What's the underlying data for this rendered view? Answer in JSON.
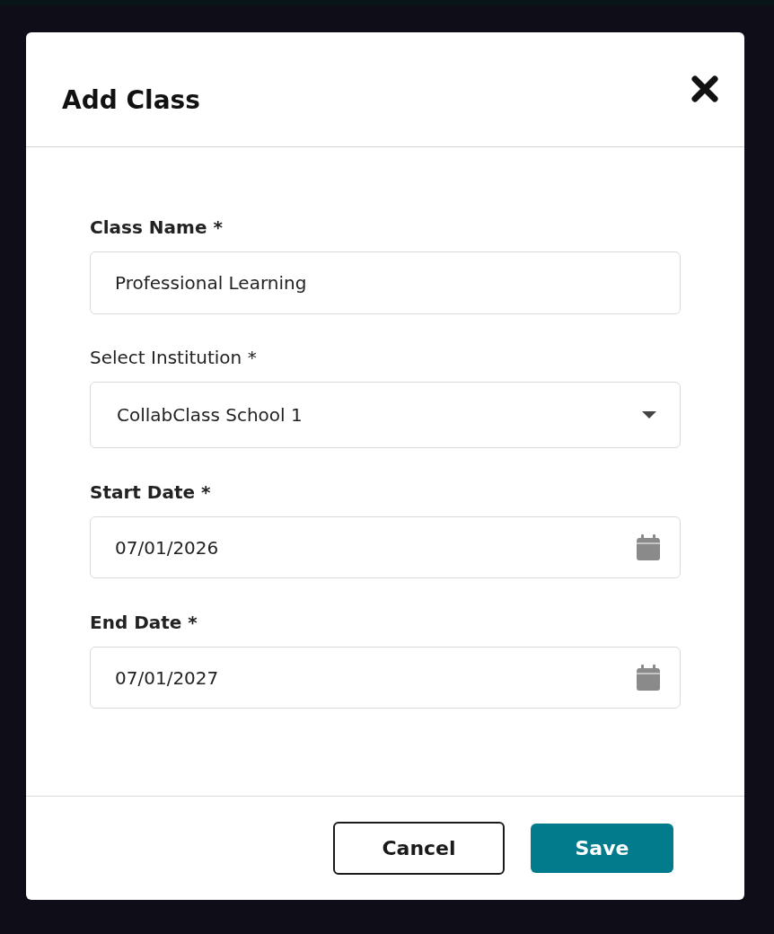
{
  "dialog": {
    "title": "Add Class"
  },
  "fields": [
    {
      "kind": "text",
      "label": "Class Name *",
      "label_bold": true,
      "value": "Professional Learning"
    },
    {
      "kind": "select",
      "label": "Select Institution *",
      "label_bold": false,
      "value": "CollabClass School 1"
    },
    {
      "kind": "date",
      "label": "Start Date *",
      "label_bold": true,
      "value": "07/01/2026"
    },
    {
      "kind": "date",
      "label": "End Date *",
      "label_bold": true,
      "value": "07/01/2027"
    }
  ],
  "buttons": [
    {
      "kind": "secondary",
      "label": "Cancel"
    },
    {
      "kind": "primary",
      "label": "Save"
    }
  ]
}
